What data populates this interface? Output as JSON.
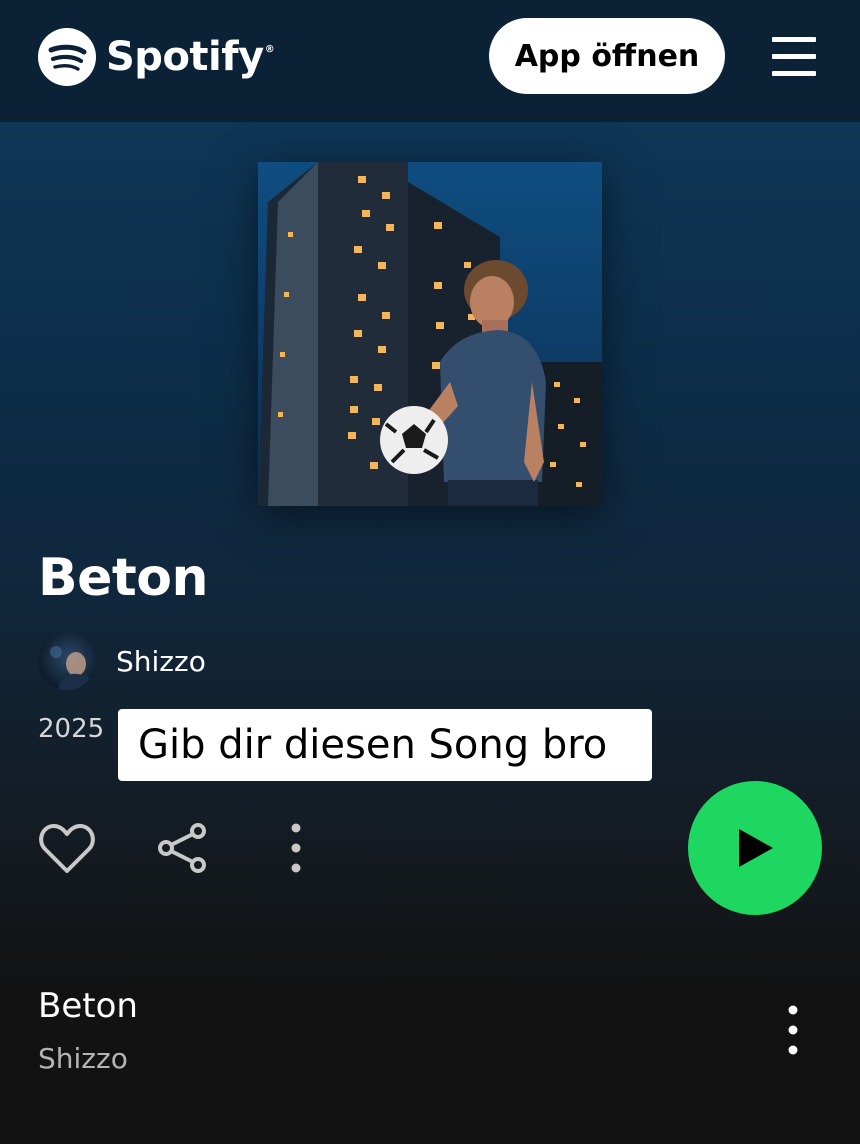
{
  "header": {
    "brand": "Spotify",
    "brand_mark": "®",
    "open_app_label": "App öffnen"
  },
  "album": {
    "title": "Beton",
    "artist": "Shizzo",
    "year": "2025"
  },
  "overlay_caption": "Gib dir diesen Song bro",
  "actions": {
    "like_icon": "heart-outline-icon",
    "share_icon": "share-icon",
    "more_icon": "more-vertical-icon",
    "play_icon": "play-icon"
  },
  "tracks": [
    {
      "title": "Beton",
      "artist": "Shizzo"
    }
  ],
  "colors": {
    "accent": "#1ed760",
    "header_bg": "#0b2236",
    "background": "#121212"
  }
}
